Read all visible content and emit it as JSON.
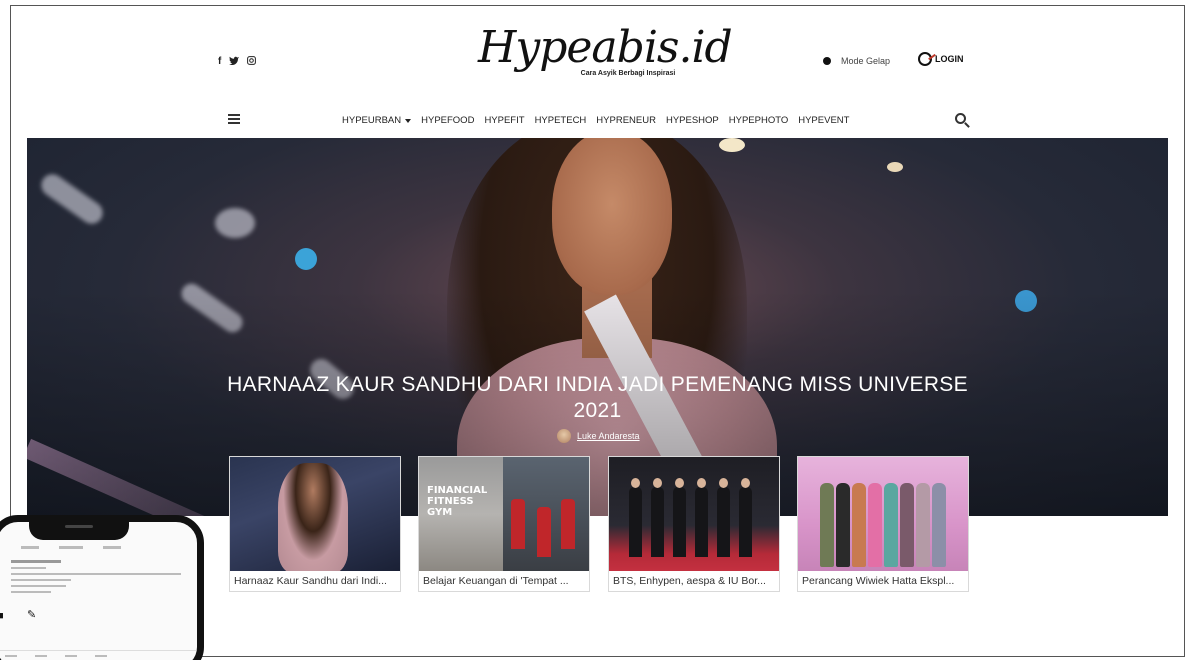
{
  "header": {
    "social_icons": [
      {
        "name": "facebook-icon",
        "glyph": "f"
      },
      {
        "name": "twitter-icon",
        "glyph": "🐦"
      },
      {
        "name": "instagram-icon",
        "glyph": "◎"
      }
    ],
    "logo": "Hypeabis.id",
    "tagline": "Cara Asyik Berbagi Inspirasi",
    "dark_mode_label": "Mode Gelap",
    "login_label": "LOGIN"
  },
  "nav": {
    "items": [
      "HYPEURBAN",
      "HYPEFOOD",
      "HYPEFIT",
      "HYPETECH",
      "HYPRENEUR",
      "HYPESHOP",
      "HYPEPHOTO",
      "HYPEVENT"
    ]
  },
  "hero": {
    "title": "HARNAAZ KAUR SANDHU DARI INDIA JADI PEMENANG MISS UNIVERSE 2021",
    "author": "Luke Andaresta"
  },
  "cards": [
    {
      "caption": "Harnaaz Kaur Sandhu dari Indi..."
    },
    {
      "caption": "Belajar Keuangan di 'Tempat ...",
      "sign_text": "FINANCIAL FITNESS GYM"
    },
    {
      "caption": "BTS, Enhypen, aespa & IU Bor..."
    },
    {
      "caption": "Perancang Wiwiek Hatta Ekspl..."
    }
  ],
  "colors": {
    "accent_red": "#c0392b",
    "text_dark": "#222222",
    "frame_border": "#555555"
  }
}
